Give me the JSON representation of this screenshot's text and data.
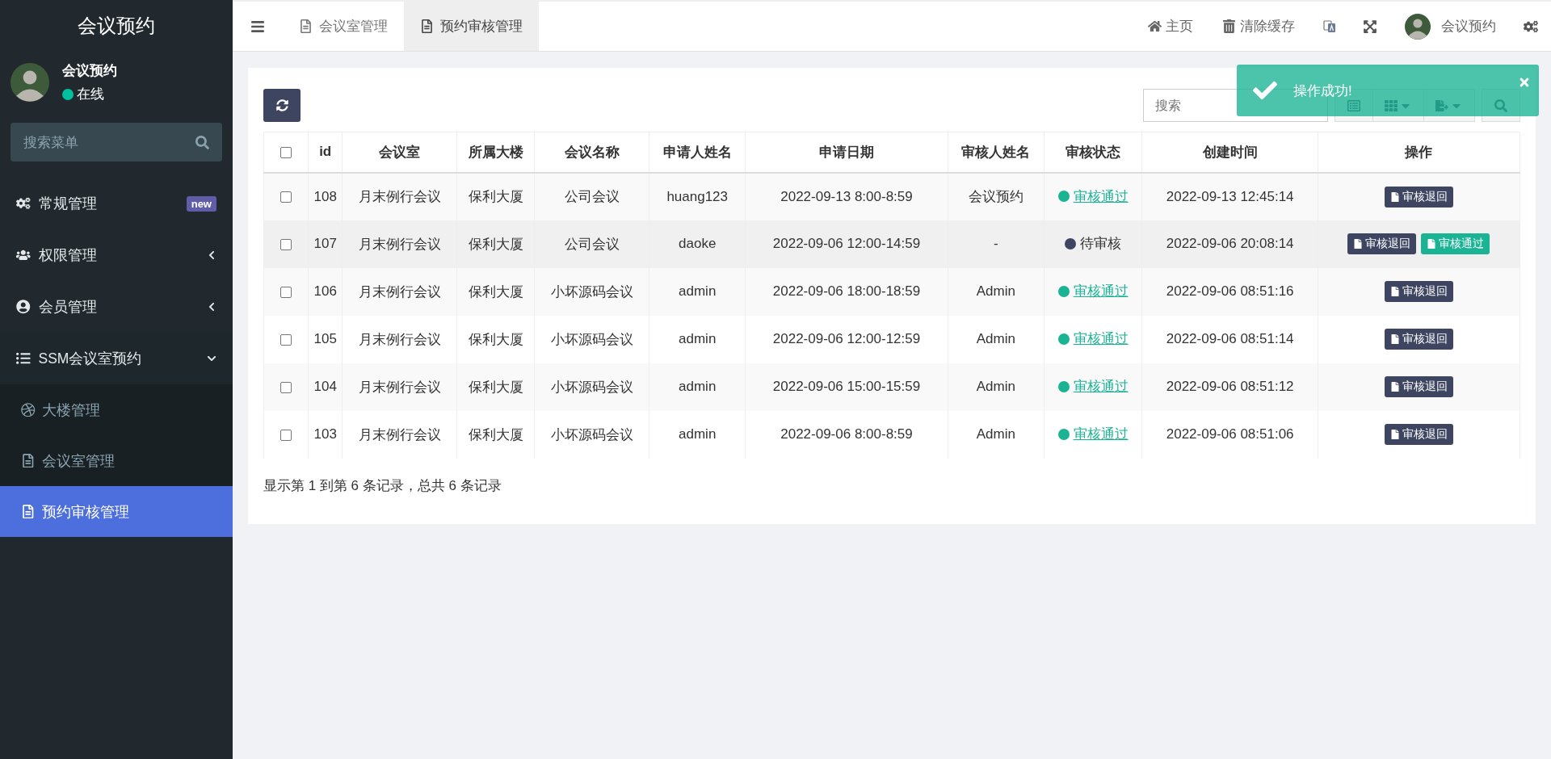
{
  "sidebar": {
    "title": "会议预约",
    "user": {
      "name": "会议预约",
      "status": "在线"
    },
    "search": {
      "placeholder": "搜索菜单"
    },
    "items": [
      {
        "label": "常规管理",
        "badge": "new",
        "has_arrow": false
      },
      {
        "label": "权限管理",
        "expanded": false,
        "has_arrow": true
      },
      {
        "label": "会员管理",
        "expanded": false,
        "has_arrow": true
      },
      {
        "label": "SSM会议室预约",
        "expanded": true,
        "has_arrow": true,
        "children": [
          {
            "label": "大楼管理",
            "selected": false
          },
          {
            "label": "会议室管理",
            "selected": false
          },
          {
            "label": "预约审核管理",
            "selected": true
          }
        ]
      }
    ]
  },
  "topbar": {
    "tabs": [
      {
        "label": "会议室管理",
        "selected": false
      },
      {
        "label": "预约审核管理",
        "selected": true
      }
    ],
    "links": [
      {
        "label": "主页"
      },
      {
        "label": "清除缓存"
      }
    ],
    "user": "会议预约"
  },
  "toolbar": {
    "search": {
      "placeholder": "搜索"
    }
  },
  "toast": {
    "message": "操作成功!"
  },
  "table": {
    "header_checked": false,
    "columns": [
      "id",
      "会议室",
      "所属大楼",
      "会议名称",
      "申请人姓名",
      "申请日期",
      "审核人姓名",
      "审核状态",
      "创建时间",
      "操作"
    ],
    "rows": [
      {
        "checked": false,
        "highlighted": false,
        "cells": [
          "108",
          "月末例行会议",
          "保利大厦",
          "公司会议",
          "huang123",
          "2022-09-13 8:00-8:59",
          "会议预约"
        ],
        "status": {
          "text": "审核通过",
          "color": "#1ab394",
          "link": true
        },
        "created": "2022-09-13 12:45:14",
        "actions": [
          {
            "kind": "reject",
            "label": "审核退回"
          }
        ]
      },
      {
        "checked": false,
        "highlighted": true,
        "cells": [
          "107",
          "月末例行会议",
          "保利大厦",
          "公司会议",
          "daoke",
          "2022-09-06 12:00-14:59",
          "-"
        ],
        "status": {
          "text": "待审核",
          "color": "#3d4561",
          "link": false
        },
        "created": "2022-09-06 20:08:14",
        "actions": [
          {
            "kind": "reject",
            "label": "审核退回"
          },
          {
            "kind": "approve",
            "label": "审核通过"
          }
        ]
      },
      {
        "checked": false,
        "highlighted": false,
        "cells": [
          "106",
          "月末例行会议",
          "保利大厦",
          "小坏源码会议",
          "admin",
          "2022-09-06 18:00-18:59",
          "Admin"
        ],
        "status": {
          "text": "审核通过",
          "color": "#1ab394",
          "link": true
        },
        "created": "2022-09-06 08:51:16",
        "actions": [
          {
            "kind": "reject",
            "label": "审核退回"
          }
        ]
      },
      {
        "checked": false,
        "highlighted": false,
        "cells": [
          "105",
          "月末例行会议",
          "保利大厦",
          "小坏源码会议",
          "admin",
          "2022-09-06 12:00-12:59",
          "Admin"
        ],
        "status": {
          "text": "审核通过",
          "color": "#1ab394",
          "link": true
        },
        "created": "2022-09-06 08:51:14",
        "actions": [
          {
            "kind": "reject",
            "label": "审核退回"
          }
        ]
      },
      {
        "checked": false,
        "highlighted": false,
        "cells": [
          "104",
          "月末例行会议",
          "保利大厦",
          "小坏源码会议",
          "admin",
          "2022-09-06 15:00-15:59",
          "Admin"
        ],
        "status": {
          "text": "审核通过",
          "color": "#1ab394",
          "link": true
        },
        "created": "2022-09-06 08:51:12",
        "actions": [
          {
            "kind": "reject",
            "label": "审核退回"
          }
        ]
      },
      {
        "checked": false,
        "highlighted": false,
        "cells": [
          "103",
          "月末例行会议",
          "保利大厦",
          "小坏源码会议",
          "admin",
          "2022-09-06 8:00-8:59",
          "Admin"
        ],
        "status": {
          "text": "审核通过",
          "color": "#1ab394",
          "link": true
        },
        "created": "2022-09-06 08:51:06",
        "actions": [
          {
            "kind": "reject",
            "label": "审核退回"
          }
        ]
      }
    ]
  },
  "pagination": {
    "summary": "显示第 1 到第 6 条记录，总共 6 条记录"
  }
}
